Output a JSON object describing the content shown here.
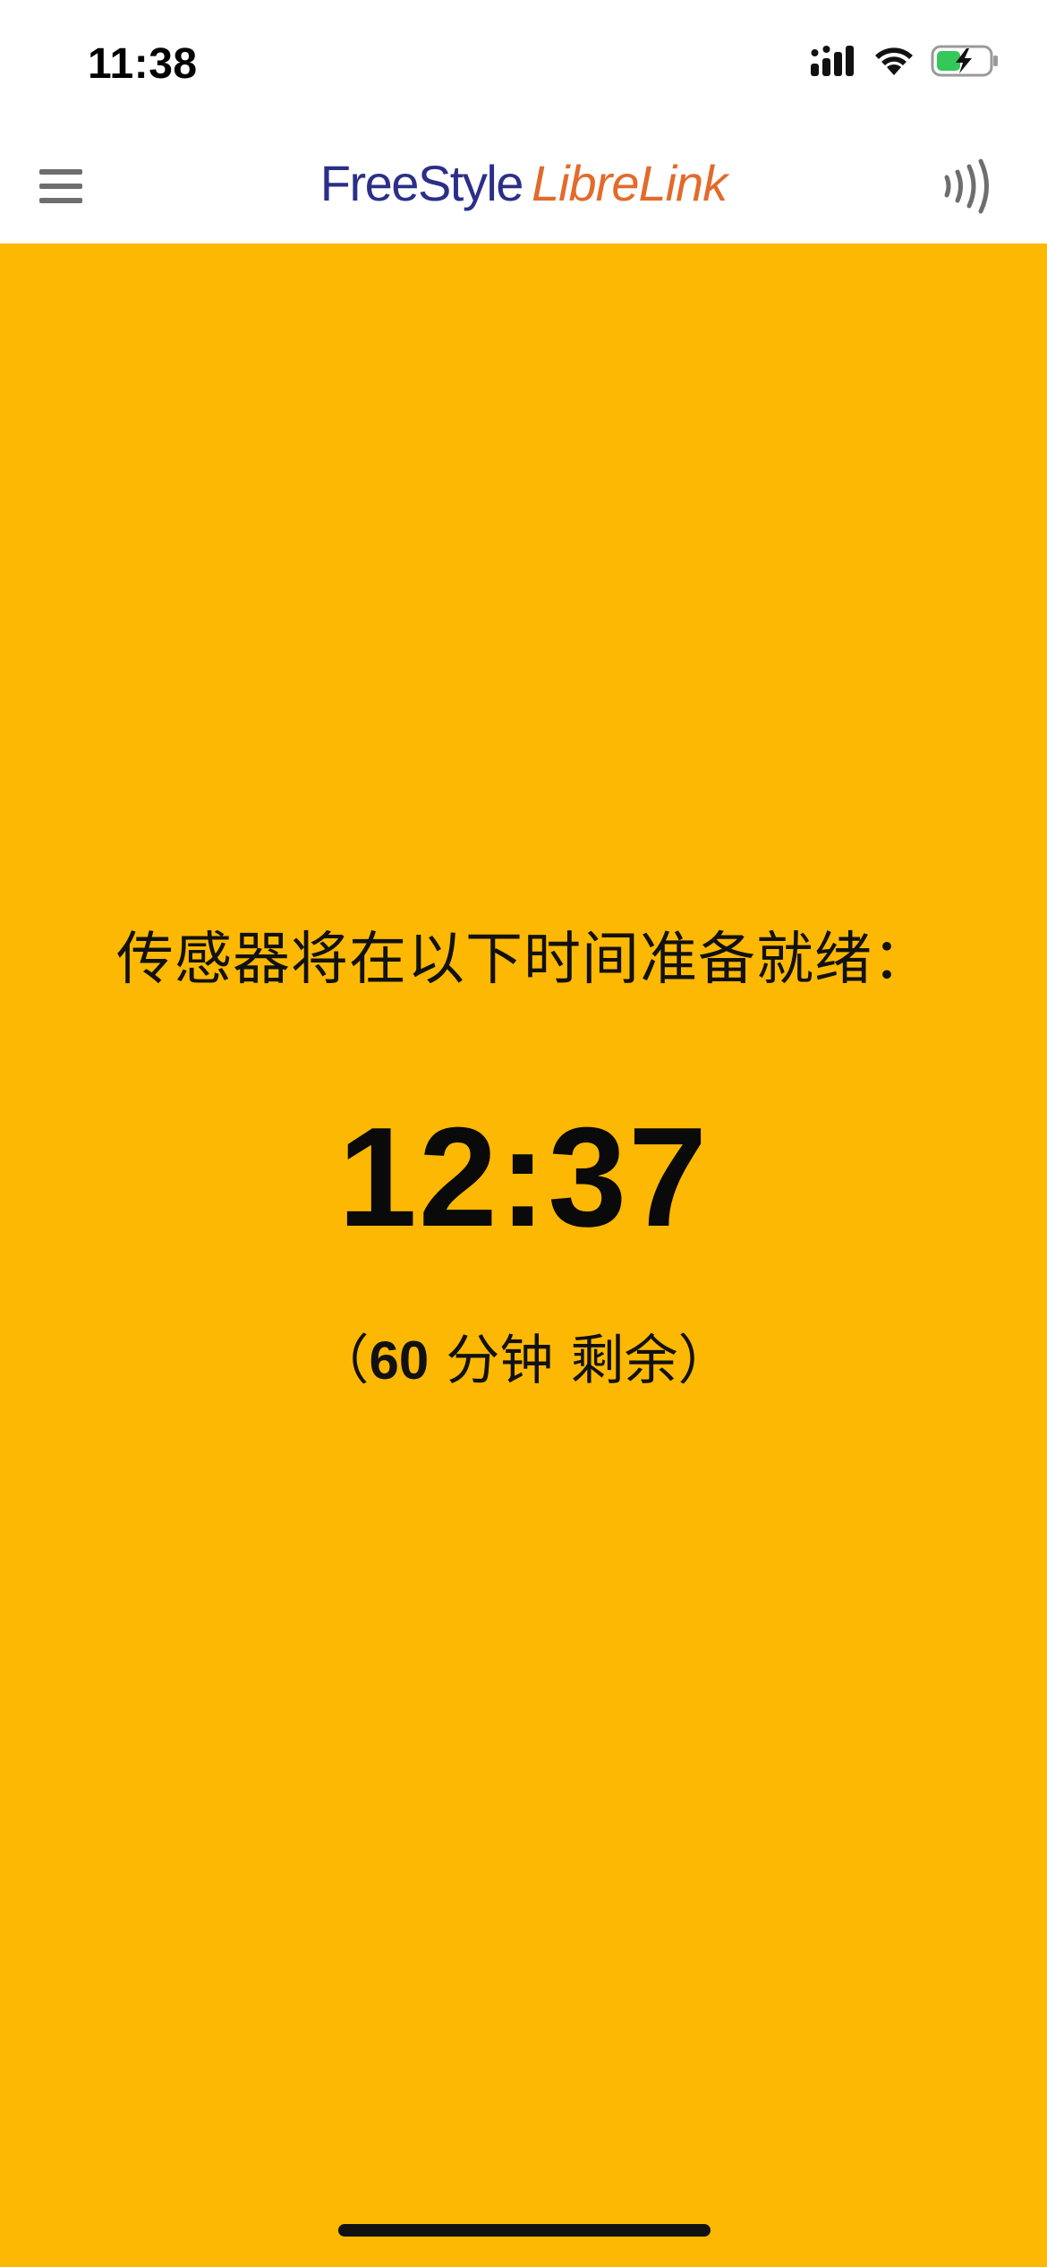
{
  "status_bar": {
    "time": "11:38",
    "icons": {
      "signal": "signal-icon",
      "wifi": "wifi-icon",
      "battery": "battery-charging-icon"
    },
    "battery_color": "#34C759"
  },
  "header": {
    "menu_icon": "menu-icon",
    "brand_part1": "FreeStyle",
    "brand_part2": "LibreLink",
    "scan_icon": "nfc-scan-icon",
    "colors": {
      "brand_blue": "#2C2F88",
      "brand_orange": "#E26B2C"
    }
  },
  "main": {
    "background_color": "#FDB803",
    "ready_label": "传感器将在以下时间准备就绪：",
    "ready_time": "12:37",
    "remaining_open": "（",
    "remaining_minutes": "60",
    "remaining_suffix": " 分钟 剩余",
    "remaining_close": "）"
  }
}
